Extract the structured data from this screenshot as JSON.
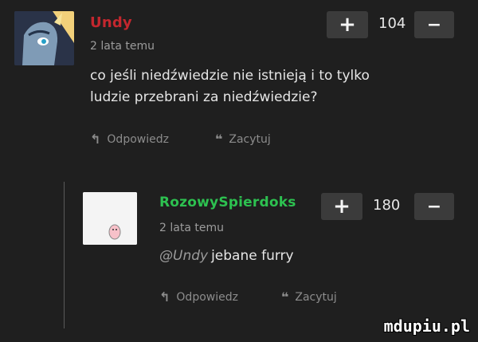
{
  "comments": [
    {
      "username": "Undy",
      "time": "2 lata temu",
      "text_lines": [
        "co jeśli niedźwiedzie nie istnieją i to tylko",
        "ludzie przebrani za niedźwiedzie?"
      ],
      "score": "104",
      "plus_label": "+",
      "minus_label": "−",
      "reply_label": "Odpowiedz",
      "quote_label": "Zacytuj",
      "username_color": "#c3272e"
    },
    {
      "username": "RozowySpierdoks",
      "time": "2 lata temu",
      "mention": "@Undy",
      "text": "jebane furry",
      "score": "180",
      "plus_label": "+",
      "minus_label": "−",
      "reply_label": "Odpowiedz",
      "quote_label": "Zacytuj",
      "username_color": "#2dc150"
    }
  ],
  "icons": {
    "reply": "reply-arrow-icon",
    "quote": "quote-icon"
  },
  "watermark": "mdupiu.pl"
}
